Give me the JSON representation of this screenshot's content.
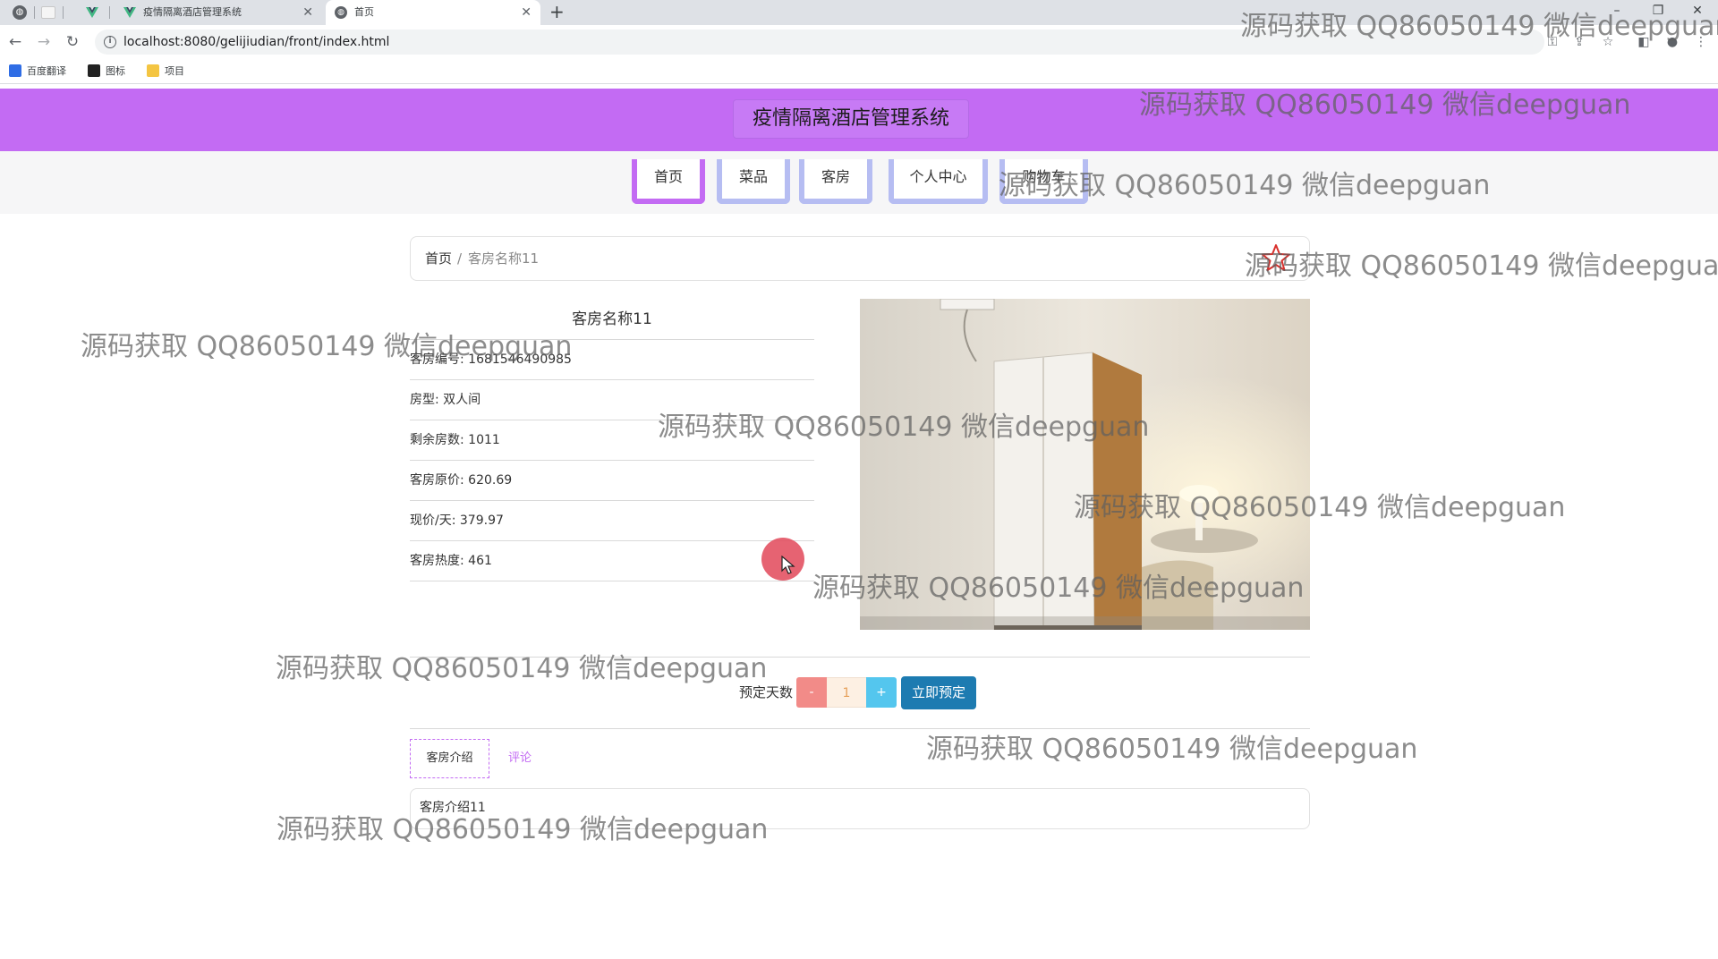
{
  "browser": {
    "tabs": [
      {
        "title": "疫情隔离酒店管理系统"
      },
      {
        "title": "首页"
      }
    ],
    "url": "localhost:8080/gelijiudian/front/index.html",
    "bookmarks": [
      "百度翻译",
      "图标",
      "项目"
    ]
  },
  "site": {
    "title": "疫情隔离酒店管理系统",
    "accent_color": "#c36bf3",
    "nav": [
      "首页",
      "菜品",
      "客房",
      "个人中心",
      "购物车"
    ]
  },
  "breadcrumb": {
    "home": "首页",
    "separator": "/",
    "current": "客房名称11"
  },
  "room": {
    "name": "客房名称11",
    "fields": [
      {
        "label": "客房编号:",
        "value": "1681546490985"
      },
      {
        "label": "房型:",
        "value": "双人间"
      },
      {
        "label": "剩余房数:",
        "value": "1011"
      },
      {
        "label": "客房原价:",
        "value": "620.69"
      },
      {
        "label": "现价/天:",
        "value": "379.97"
      },
      {
        "label": "客房热度:",
        "value": "461"
      }
    ]
  },
  "booking": {
    "days_label": "预定天数",
    "minus": "-",
    "quantity": "1",
    "plus": "+",
    "book_button": "立即预定"
  },
  "detail_tabs": {
    "intro": "客房介绍",
    "comments": "评论"
  },
  "intro_text": "客房介绍11",
  "watermark": "源码获取 QQ86050149 微信deepguan"
}
